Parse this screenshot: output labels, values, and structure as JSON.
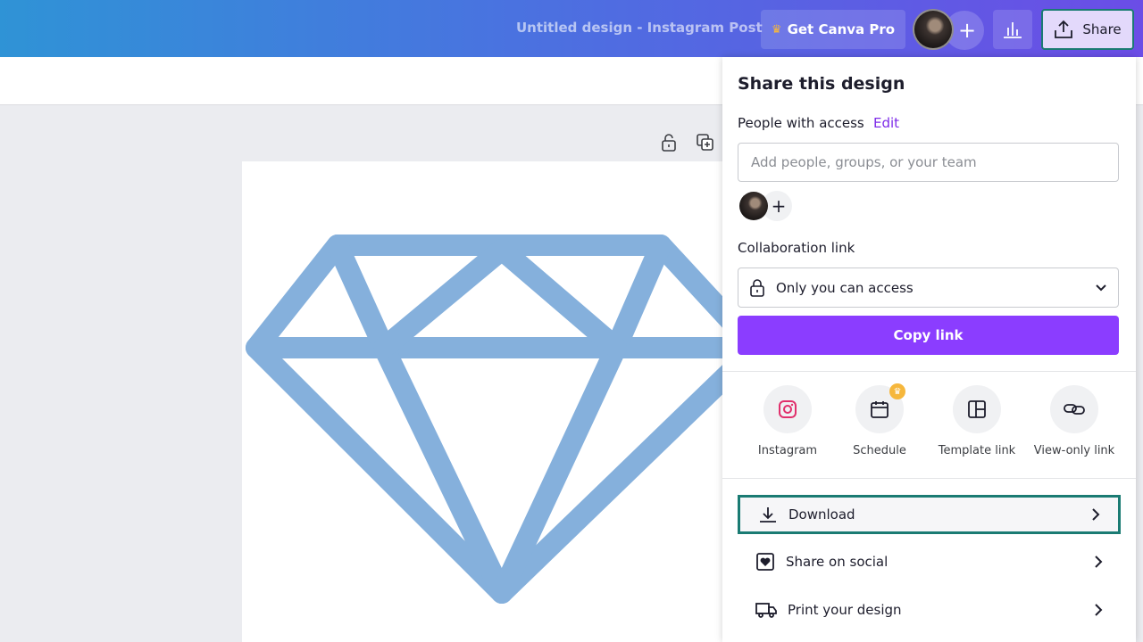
{
  "header": {
    "doc_title": "Untitled design - Instagram Post",
    "pro_label": "Get Canva Pro",
    "share_label": "Share",
    "add_label": "+"
  },
  "share_panel": {
    "title": "Share this design",
    "access_label": "People with access",
    "edit_label": "Edit",
    "people_placeholder": "Add people, groups, or your team",
    "collab_label": "Collaboration link",
    "access_value": "Only you can access",
    "copy_label": "Copy link",
    "options": [
      {
        "label": "Instagram",
        "icon": "instagram-icon"
      },
      {
        "label": "Schedule",
        "icon": "calendar-icon",
        "pro": true
      },
      {
        "label": "Template link",
        "icon": "template-icon"
      },
      {
        "label": "View-only link",
        "icon": "link-icon"
      }
    ],
    "menu": [
      {
        "label": "Download",
        "icon": "download-icon",
        "highlighted": true
      },
      {
        "label": "Share on social",
        "icon": "heart-icon"
      },
      {
        "label": "Print your design",
        "icon": "truck-icon"
      }
    ]
  },
  "colors": {
    "accent": "#8b3dff",
    "highlight_border": "#1a7b73",
    "diamond": "#85b0dc"
  }
}
